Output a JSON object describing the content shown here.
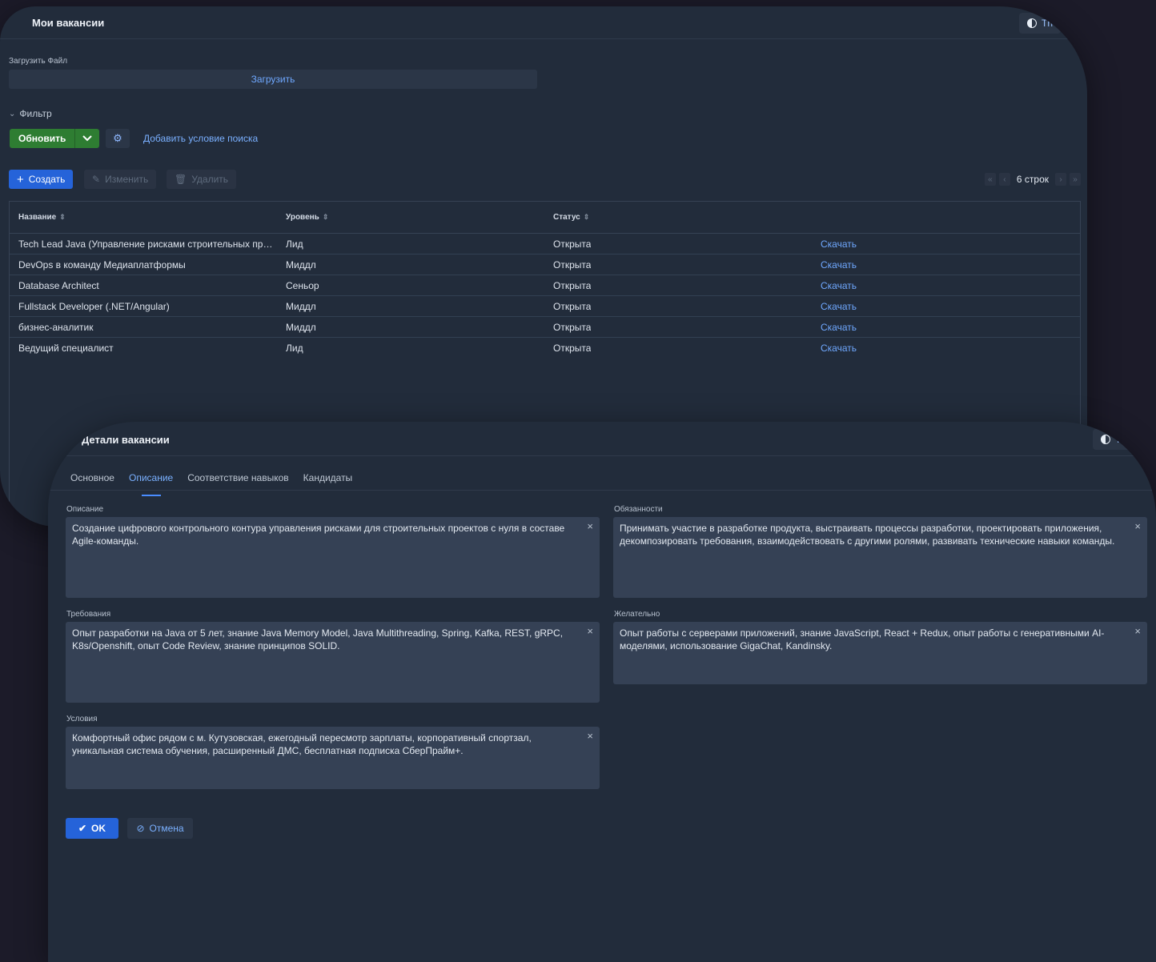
{
  "vacancies_window": {
    "title": "Мои вакансии",
    "theme_label": "Th",
    "upload_label": "Загрузить Файл",
    "upload_button": "Загрузить",
    "filter_label": "Фильтр",
    "refresh_button": "Обновить",
    "add_condition": "Добавить условие поиска",
    "create_button": "Создать",
    "edit_button": "Изменить",
    "delete_button": "Удалить",
    "row_count": "6 строк",
    "columns": [
      "Название",
      "Уровень",
      "Статус"
    ],
    "rows": [
      {
        "name": "Tech Lead Java (Управление рисками строительных про...",
        "level": "Лид",
        "status": "Открыта",
        "action": "Скачать"
      },
      {
        "name": "DevOps в команду Медиаплатформы",
        "level": "Миддл",
        "status": "Открыта",
        "action": "Скачать"
      },
      {
        "name": "Database Architect",
        "level": "Сеньор",
        "status": "Открыта",
        "action": "Скачать"
      },
      {
        "name": "Fullstack Developer (.NET/Angular)",
        "level": "Миддл",
        "status": "Открыта",
        "action": "Скачать"
      },
      {
        "name": "бизнес-аналитик",
        "level": "Миддл",
        "status": "Открыта",
        "action": "Скачать"
      },
      {
        "name": "Ведущий специалист",
        "level": "Лид",
        "status": "Открыта",
        "action": "Скачать"
      }
    ]
  },
  "details_window": {
    "title": "Детали вакансии",
    "theme_label": "Th",
    "tabs": [
      "Основное",
      "Описание",
      "Соответствие навыков",
      "Кандидаты"
    ],
    "active_tab": "Описание",
    "fields": {
      "description": {
        "label": "Описание",
        "value": "Создание цифрового контрольного контура управления рисками для строительных проектов с нуля в составе Agile-команды."
      },
      "duties": {
        "label": "Обязанности",
        "value": "Принимать участие в разработке продукта, выстраивать процессы разработки, проектировать приложения, декомпозировать требования, взаимодействовать с другими ролями, развивать технические навыки команды."
      },
      "requirements": {
        "label": "Требования",
        "value": "Опыт разработки на Java от 5 лет, знание Java Memory Model, Java Multithreading, Spring, Kafka, REST, gRPC, K8s/Openshift, опыт Code Review, знание принципов SOLID."
      },
      "desirable": {
        "label": "Желательно",
        "value": "Опыт работы с серверами приложений, знание JavaScript, React + Redux, опыт работы с генеративными AI-моделями, использование GigaChat, Kandinsky."
      },
      "conditions": {
        "label": "Условия",
        "value": "Комфортный офис рядом с м. Кутузовская, ежегодный пересмотр зарплаты, корпоративный спортзал, уникальная система обучения, расширенный ДМС, бесплатная подписка СберПрайм+."
      }
    },
    "ok_button": "OK",
    "cancel_button": "Отмена"
  },
  "colors": {
    "background": "#1c1b29",
    "panel": "#222c3b",
    "accent": "#2563d9",
    "success": "#2e7d32",
    "link": "#6fa8ff"
  }
}
